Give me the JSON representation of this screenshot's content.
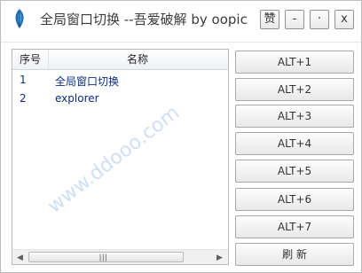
{
  "window": {
    "title": "全局窗口切换 --吾爱破解 by oopic",
    "buttons": {
      "like_label": "赞",
      "minimize_label": "-",
      "dot_label": "·",
      "close_label": "x"
    }
  },
  "list": {
    "columns": [
      "序号",
      "名称"
    ],
    "rows": [
      {
        "index": "1",
        "name": "全局窗口切换"
      },
      {
        "index": "2",
        "name": "explorer"
      }
    ]
  },
  "actions": [
    "ALT+1",
    "ALT+2",
    "ALT+3",
    "ALT+4",
    "ALT+5",
    "ALT+6",
    "ALT+7"
  ],
  "refresh_label": "刷 新",
  "watermark": {
    "text": "www.ddooo.com"
  }
}
